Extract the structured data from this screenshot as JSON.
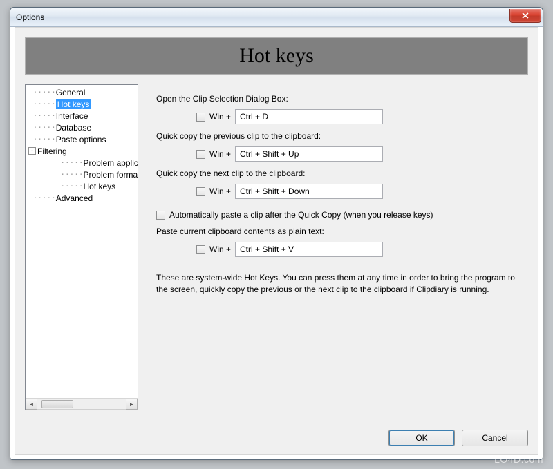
{
  "window": {
    "title": "Options"
  },
  "banner": {
    "heading": "Hot keys"
  },
  "tree": {
    "items": [
      {
        "label": "General",
        "depth": 0
      },
      {
        "label": "Hot keys",
        "depth": 0,
        "selected": true
      },
      {
        "label": "Interface",
        "depth": 0
      },
      {
        "label": "Database",
        "depth": 0
      },
      {
        "label": "Paste options",
        "depth": 0
      },
      {
        "label": "Filtering",
        "depth": 0,
        "expander": "-"
      },
      {
        "label": "Problem applicat",
        "depth": 1
      },
      {
        "label": "Problem formats",
        "depth": 1
      },
      {
        "label": "Hot keys",
        "depth": 1
      },
      {
        "label": "Advanced",
        "depth": 0
      }
    ],
    "scroll_thumb_label": "III"
  },
  "hotkeys": {
    "open_dialog": {
      "label": "Open the Clip Selection Dialog Box:",
      "win_label": "Win +",
      "win_checked": false,
      "value": "Ctrl + D"
    },
    "quick_prev": {
      "label": "Quick copy the previous clip to the clipboard:",
      "win_label": "Win +",
      "win_checked": false,
      "value": "Ctrl + Shift + Up"
    },
    "quick_next": {
      "label": "Quick copy the next clip to the clipboard:",
      "win_label": "Win +",
      "win_checked": false,
      "value": "Ctrl + Shift + Down"
    },
    "auto_paste": {
      "checked": false,
      "label": "Automatically paste a clip after the Quick Copy (when you release keys)"
    },
    "paste_plain": {
      "label": "Paste current clipboard contents as plain text:",
      "win_label": "Win +",
      "win_checked": false,
      "value": "Ctrl + Shift + V"
    },
    "note": "These are system-wide Hot Keys. You can press them at any time in order to bring the program to the screen, quickly copy the previous or the next clip to the clipboard if Clipdiary is running."
  },
  "buttons": {
    "ok": "OK",
    "cancel": "Cancel"
  },
  "watermark": "LO4D.com"
}
